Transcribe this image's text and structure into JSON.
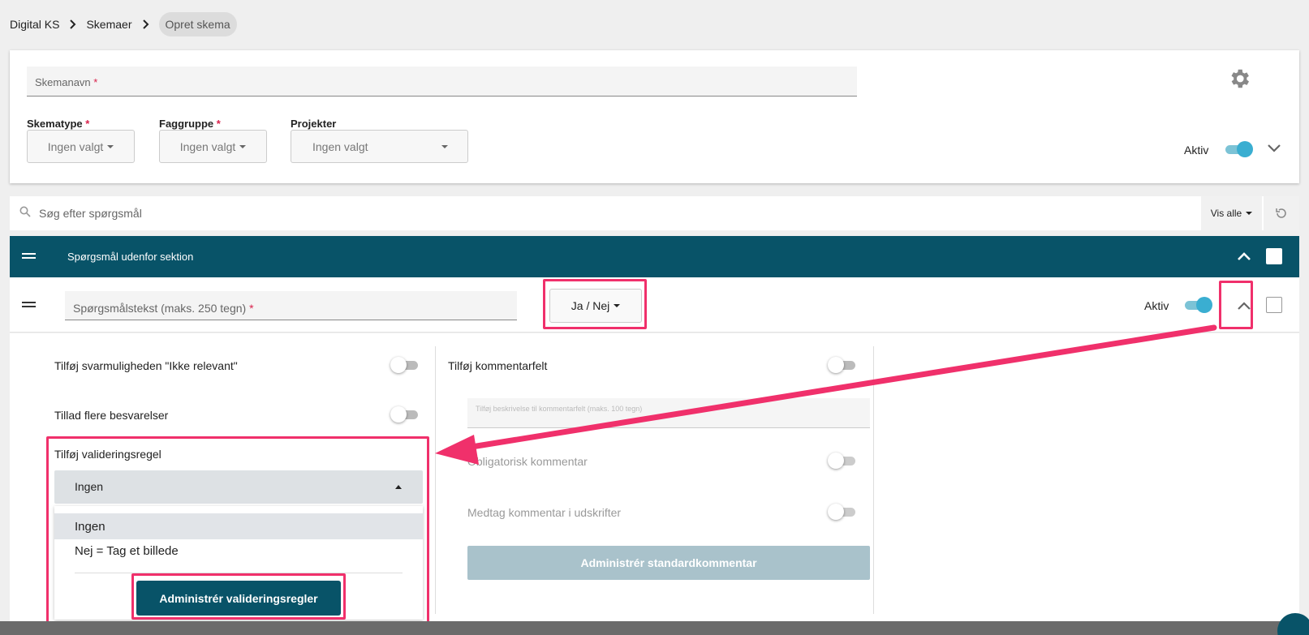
{
  "breadcrumb": {
    "items": [
      "Digital KS",
      "Skemaer"
    ],
    "current": "Opret skema"
  },
  "form": {
    "name_placeholder": "Skemanavn",
    "required_mark": "*",
    "skematype": {
      "label": "Skematype",
      "value": "Ingen valgt"
    },
    "faggruppe": {
      "label": "Faggruppe",
      "value": "Ingen valgt"
    },
    "projekter": {
      "label": "Projekter",
      "value": "Ingen valgt"
    },
    "aktiv_label": "Aktiv",
    "aktiv_on": true
  },
  "search": {
    "placeholder": "Søg efter spørgsmål",
    "filter_label": "Vis alle"
  },
  "section": {
    "title": "Spørgsmål udenfor sektion"
  },
  "question": {
    "text_placeholder": "Spørgsmålstekst (maks. 250 tegn)",
    "answer_type": "Ja / Nej",
    "aktiv_label": "Aktiv"
  },
  "options": {
    "ikke_relevant": "Tilføj svarmuligheden \"Ikke relevant\"",
    "flere_besvarelser": "Tillad flere besvarelser",
    "validering_label": "Tilføj valideringsregel",
    "kommentarfelt": "Tilføj kommentarfelt",
    "kommentar_placeholder": "Tilføj beskrivelse til kommentarfelt (maks. 100 tegn)",
    "obligatorisk": "Obligatorisk kommentar",
    "medtag": "Medtag kommentar i udskrifter",
    "std_button": "Administrér standardkommentar"
  },
  "dropdown": {
    "selected": "Ingen",
    "items": [
      "Ingen",
      "Nej = Tag et billede"
    ],
    "admin_button": "Administrér valideringsregler"
  },
  "colors": {
    "brand": "#085368",
    "highlight": "#f0306b",
    "toggle_on": "#3aaed1"
  }
}
